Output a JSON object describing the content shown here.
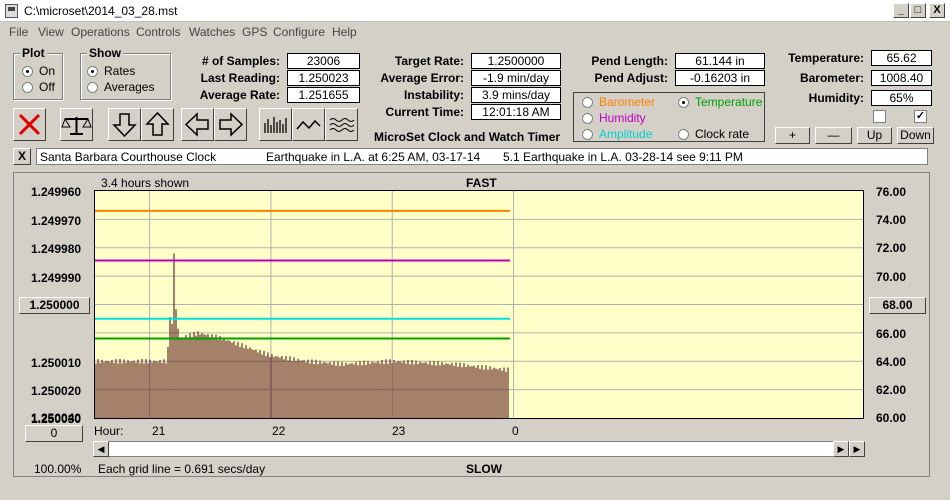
{
  "window": {
    "title": "C:\\microset\\2014_03_28.mst",
    "buttons": [
      "_",
      "□",
      "X"
    ]
  },
  "menu": [
    "File",
    "View",
    "Operations",
    "Controls",
    "Watches",
    "GPS",
    "Configure",
    "Help"
  ],
  "plot_group": {
    "title": "Plot",
    "options": [
      "On",
      "Off"
    ],
    "selected": "On"
  },
  "show_group": {
    "title": "Show",
    "options": [
      "Rates",
      "Averages"
    ],
    "selected": "Rates"
  },
  "stats": {
    "samples_label": "# of Samples:",
    "samples": "23006",
    "last_reading_label": "Last Reading:",
    "last_reading": "1.250023",
    "average_rate_label": "Average Rate:",
    "average_rate": "1.251655",
    "target_rate_label": "Target Rate:",
    "target_rate": "1.2500000",
    "average_error_label": "Average Error:",
    "average_error": "-1.9 min/day",
    "instability_label": "Instability:",
    "instability": "3.9 mins/day",
    "current_time_label": "Current Time:",
    "current_time": "12:01:18 AM",
    "pend_length_label": "Pend Length:",
    "pend_length": "61.144 in",
    "pend_adjust_label": "Pend Adjust:",
    "pend_adjust": "-0.16203 in",
    "temperature_label": "Temperature:",
    "temperature": "65.62",
    "barometer_label": "Barometer:",
    "barometer": "1008.40",
    "humidity_label": "Humidity:",
    "humidity": "65%"
  },
  "toolbar_icons": [
    "close-x-icon",
    "balance-icon",
    "arrow-down-icon",
    "arrow-up-icon",
    "arrow-left-icon",
    "arrow-right-icon",
    "bars-icon",
    "wave-icon",
    "squiggle-icon"
  ],
  "app_title": "MicroSet Clock and Watch Timer",
  "sensor_options": {
    "barometer": "Barometer",
    "temperature": "Temperature",
    "humidity": "Humidity",
    "amplitude": "Amplitude",
    "clock_rate": "Clock rate",
    "selected": "Temperature"
  },
  "adjust_buttons": [
    "+",
    "—",
    "Up",
    "Down"
  ],
  "checkboxes": [
    false,
    true
  ],
  "info": {
    "close_label": "X",
    "clock_name": "Santa Barbara Courthouse Clock",
    "note1": "Earthquake in L.A. at 6:25 AM, 03-17-14",
    "note2": "5.1 Earthquake in L.A. 03-28-14  see 9:11 PM"
  },
  "colors": {
    "barometer": "#ff8000",
    "humidity": "#c000c0",
    "amplitude": "#00e0e0",
    "temperature": "#00a000",
    "rate_bars": "#5a1a1a",
    "plot_bg": "#ffffc8"
  },
  "chart": {
    "hours_shown": "3.4 hours shown",
    "fast_label": "FAST",
    "slow_label": "SLOW",
    "center_value_btn": "1.250000",
    "right_value_btn": "68.00",
    "hour_btn": "0",
    "hour_label": "Hour:",
    "zoom": "100.00%",
    "grid_note": "Each grid line = 0.691 secs/day"
  },
  "chart_data": {
    "type": "bar",
    "left_axis_ticks": [
      "1.249960",
      "1.249970",
      "1.249980",
      "1.249990",
      "1.250000",
      "1.250010",
      "1.250020",
      "1.250030",
      "1.250040"
    ],
    "right_axis_ticks": [
      "76.00",
      "74.00",
      "72.00",
      "70.00",
      "68.00",
      "66.00",
      "64.00",
      "62.00",
      "60.00"
    ],
    "x_ticks": [
      "21",
      "22",
      "23",
      "0"
    ],
    "x_range_hours": [
      20.55,
      24
    ],
    "y_left_range": [
      1.24996,
      1.25004
    ],
    "y_right_range": [
      60,
      76
    ],
    "temperature_line": 65.6,
    "amplitude_line": 67.0,
    "humidity_line": 71.1,
    "barometer_line": 74.6,
    "rate_profile": [
      [
        20.55,
        1.25002
      ],
      [
        21.05,
        1.25002
      ],
      [
        21.15,
        1.25002
      ],
      [
        21.16,
        1.249995
      ],
      [
        21.18,
        1.250016
      ],
      [
        21.2,
        1.24998
      ],
      [
        21.22,
        1.250005
      ],
      [
        21.25,
        1.250012
      ],
      [
        21.4,
        1.25001
      ],
      [
        21.6,
        1.250012
      ],
      [
        21.8,
        1.250015
      ],
      [
        22.0,
        1.250018
      ],
      [
        22.3,
        1.25002
      ],
      [
        22.6,
        1.250021
      ],
      [
        23.0,
        1.25002
      ],
      [
        23.5,
        1.250021
      ],
      [
        23.95,
        1.250023
      ]
    ]
  }
}
